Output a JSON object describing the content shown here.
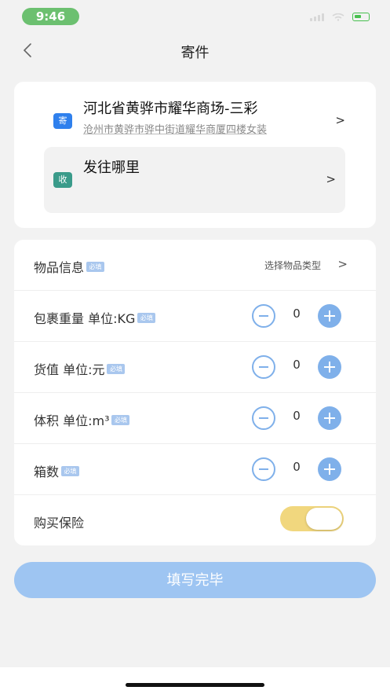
{
  "status_bar": {
    "time": "9:46",
    "accent_color": "#6cc070",
    "battery_color": "#48c04f"
  },
  "nav": {
    "title": "寄件",
    "back_icon": "chevron-left-icon"
  },
  "sender": {
    "badge": "寄",
    "address": "河北省黄骅市耀华商场-三彩",
    "detail": "沧州市黄骅市骅中街道耀华商厦四楼女装",
    "arrow": ">"
  },
  "receiver": {
    "badge": "收",
    "placeholder": "发往哪里",
    "arrow": ">"
  },
  "form": {
    "required_tag": "必填",
    "item_info": {
      "label": "物品信息",
      "select_text": "选择物品类型",
      "arrow": ">"
    },
    "weight": {
      "label": "包裹重量 单位:KG",
      "value": "0"
    },
    "value": {
      "label": "货值 单位:元",
      "value": "0"
    },
    "volume": {
      "label": "体积 单位:m³",
      "value": "0"
    },
    "boxes": {
      "label": "箱数",
      "value": "0"
    },
    "insurance": {
      "label": "购买保险",
      "enabled": true,
      "toggle_color": "#f1d77e"
    }
  },
  "submit": {
    "label": "填写完毕",
    "color": "#9ec5f2"
  }
}
